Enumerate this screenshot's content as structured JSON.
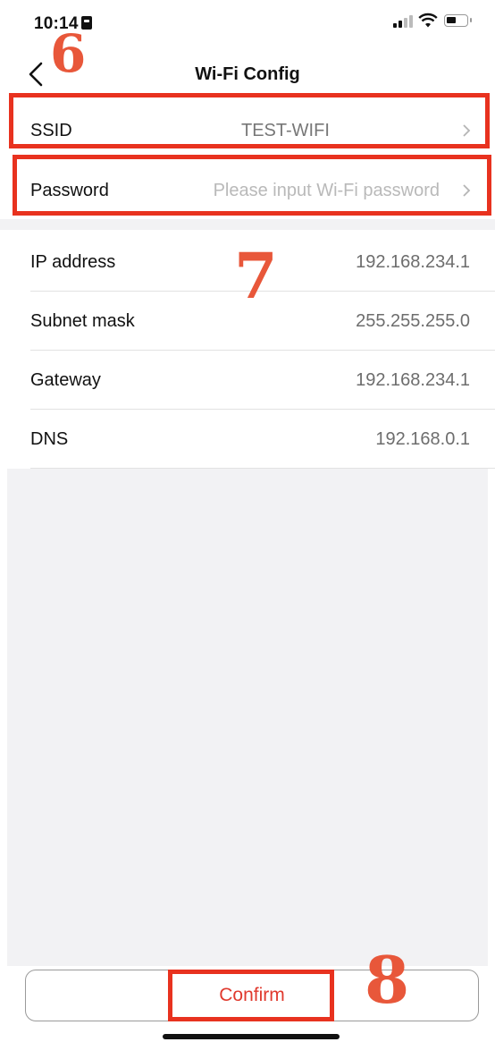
{
  "status_bar": {
    "time": "10:14"
  },
  "nav": {
    "title": "Wi-Fi Config"
  },
  "annotations": {
    "step_6": "6",
    "step_7": "7",
    "step_8": "8"
  },
  "fields": [
    {
      "label": "SSID",
      "value": "TEST-WIFI"
    },
    {
      "label": "Password",
      "placeholder": "Please input Wi-Fi password"
    },
    {
      "label": "IP address",
      "value": "192.168.234.1"
    },
    {
      "label": "Subnet mask",
      "value": "255.255.255.0"
    },
    {
      "label": "Gateway",
      "value": "192.168.234.1"
    },
    {
      "label": "DNS",
      "value": "192.168.0.1"
    }
  ],
  "confirm": {
    "label": "Confirm"
  },
  "colors": {
    "accent": "#e03a2e",
    "highlight": "#e8321f",
    "annotation": "#e8573a"
  }
}
